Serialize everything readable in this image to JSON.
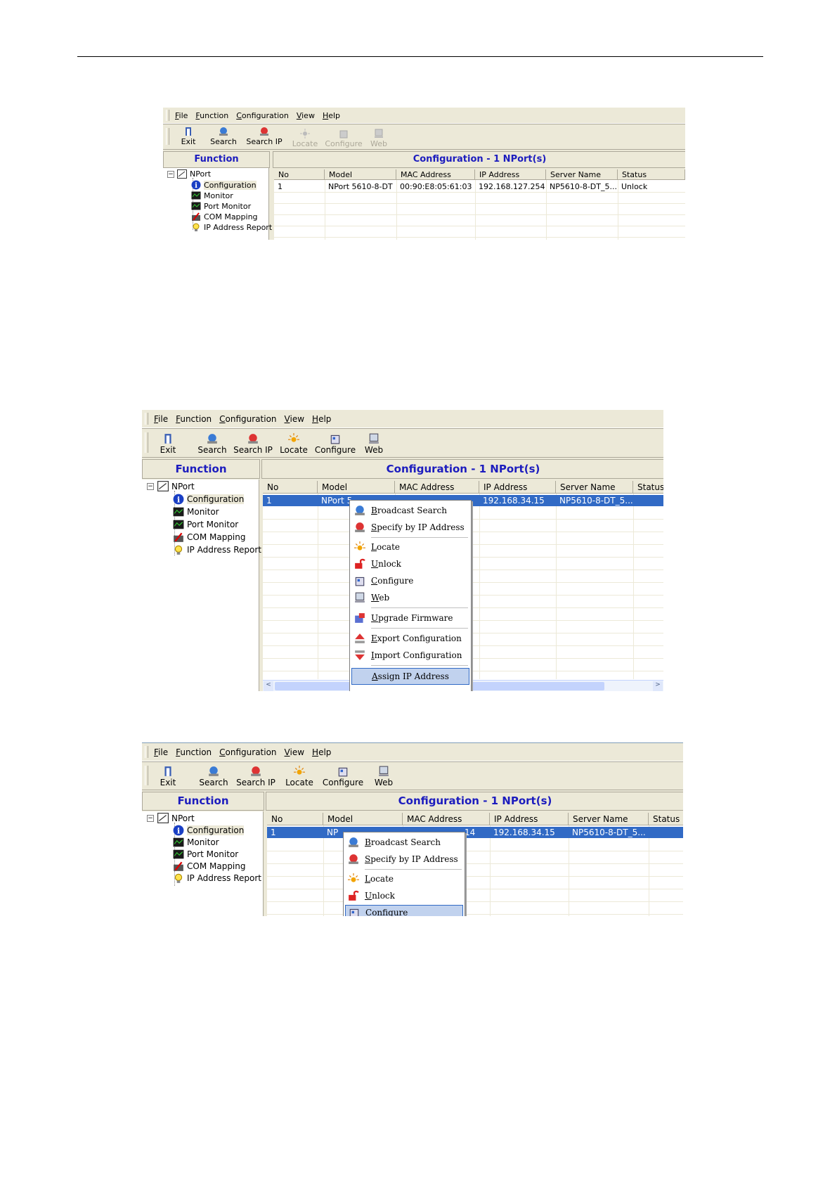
{
  "menu": [
    "File",
    "Function",
    "Configuration",
    "View",
    "Help"
  ],
  "toolbar": {
    "exit": "Exit",
    "search": "Search",
    "search_ip": "Search IP",
    "locate": "Locate",
    "configure": "Configure",
    "web": "Web"
  },
  "function_title": "Function",
  "tree": {
    "root": "NPort",
    "items": [
      "Configuration",
      "Monitor",
      "Port Monitor",
      "COM Mapping",
      "IP Address Report"
    ]
  },
  "config_title": "Configuration - 1 NPort(s)",
  "columns": [
    "No",
    "Model",
    "MAC Address",
    "IP Address",
    "Server Name",
    "Status"
  ],
  "shot1": {
    "row": {
      "no": "1",
      "model": "NPort 5610-8-DT",
      "mac": "00:90:E8:05:61:03",
      "ip": "192.168.127.254",
      "server": "NP5610-8-DT_5...",
      "status": "Unlock"
    }
  },
  "shot2": {
    "row": {
      "no": "1",
      "model_partial": "NPort 5",
      "ip": "192.168.34.15",
      "server": "NP5610-8-DT_5..."
    },
    "context_menu": [
      "Broadcast Search",
      "Specify by IP Address",
      "Locate",
      "Unlock",
      "Configure",
      "Web",
      "Upgrade Firmware",
      "Export Configuration",
      "Import Configuration",
      "Assign IP Address"
    ],
    "highlighted": "Assign IP Address"
  },
  "shot3": {
    "row": {
      "no": "1",
      "model_partial": "NP",
      "mac_partial": "14",
      "ip": "192.168.34.15",
      "server": "NP5610-8-DT_5..."
    },
    "context_menu": [
      "Broadcast Search",
      "Specify by IP Address",
      "Locate",
      "Unlock",
      "Configure"
    ],
    "highlighted": "Configure"
  }
}
